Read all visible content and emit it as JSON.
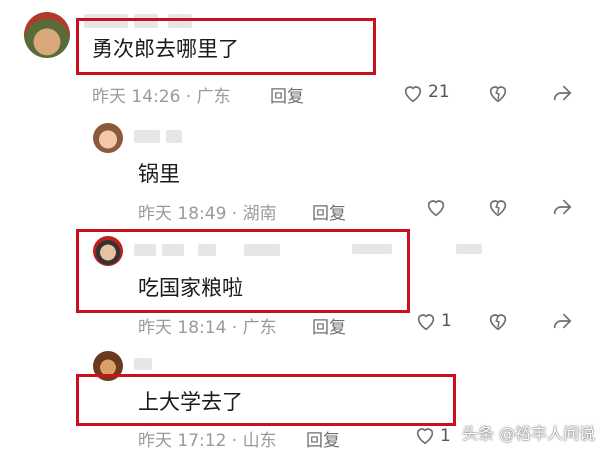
{
  "colors": {
    "highlight": "#c8101e",
    "meta_text": "#9a9a9a",
    "icon": "#6f6f6f"
  },
  "comments": [
    {
      "text": "勇次郎去哪里了",
      "time": "昨天 14:26 · 广东",
      "reply": "回复",
      "likes": "21"
    },
    {
      "text": "锅里",
      "time": "昨天 18:49 · 湖南",
      "reply": "回复",
      "likes": ""
    },
    {
      "text": "吃国家粮啦",
      "time": "昨天 18:14 · 广东",
      "reply": "回复",
      "likes": "1"
    },
    {
      "text": "上大学去了",
      "time": "昨天 17:12 · 山东",
      "reply": "回复",
      "likes": "1"
    }
  ],
  "icons": {
    "like": "heart-icon",
    "dislike": "broken-heart-icon",
    "share": "share-arrow-icon"
  },
  "watermark": "头条 @裕丰人间说"
}
